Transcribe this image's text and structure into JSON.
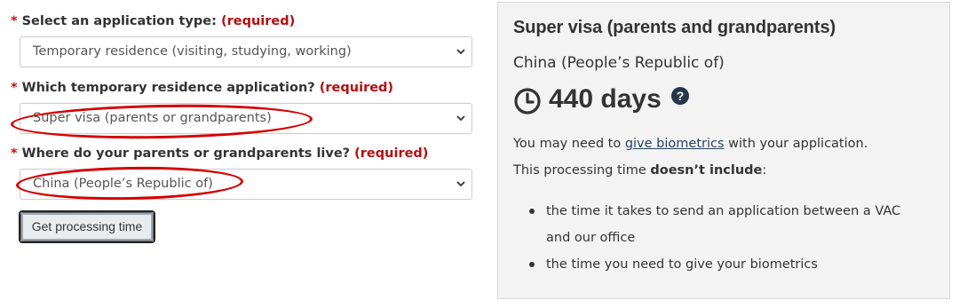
{
  "form": {
    "star": "*",
    "q1": {
      "label": "Select an application type:",
      "required": "(required)",
      "value": "Temporary residence (visiting, studying, working)"
    },
    "q2": {
      "label": "Which temporary residence application?",
      "required": "(required)",
      "value": "Super visa (parents or grandparents)"
    },
    "q3": {
      "label": "Where do your parents or grandparents live?",
      "required": "(required)",
      "value": "China (People’s Republic of)"
    },
    "button_label": "Get processing time",
    "annotation_color": "#d40000"
  },
  "result": {
    "title": "Super visa (parents and grandparents)",
    "country": "China (People’s Republic of)",
    "days": "440 days",
    "help_icon": "question-circle-icon",
    "clock_icon": "clock-icon",
    "p1_before": "You may need to ",
    "p1_link": "give biometrics",
    "p1_after": " with your application.",
    "p2_before": "This processing time ",
    "p2_bold": "doesn’t include",
    "p2_after": ":",
    "items": [
      {
        "text_line1": "the time it takes to send an application between a VAC",
        "text_line2": "and our office"
      },
      {
        "text_line1": "the time you need to give your biometrics",
        "text_line2": ""
      }
    ]
  }
}
